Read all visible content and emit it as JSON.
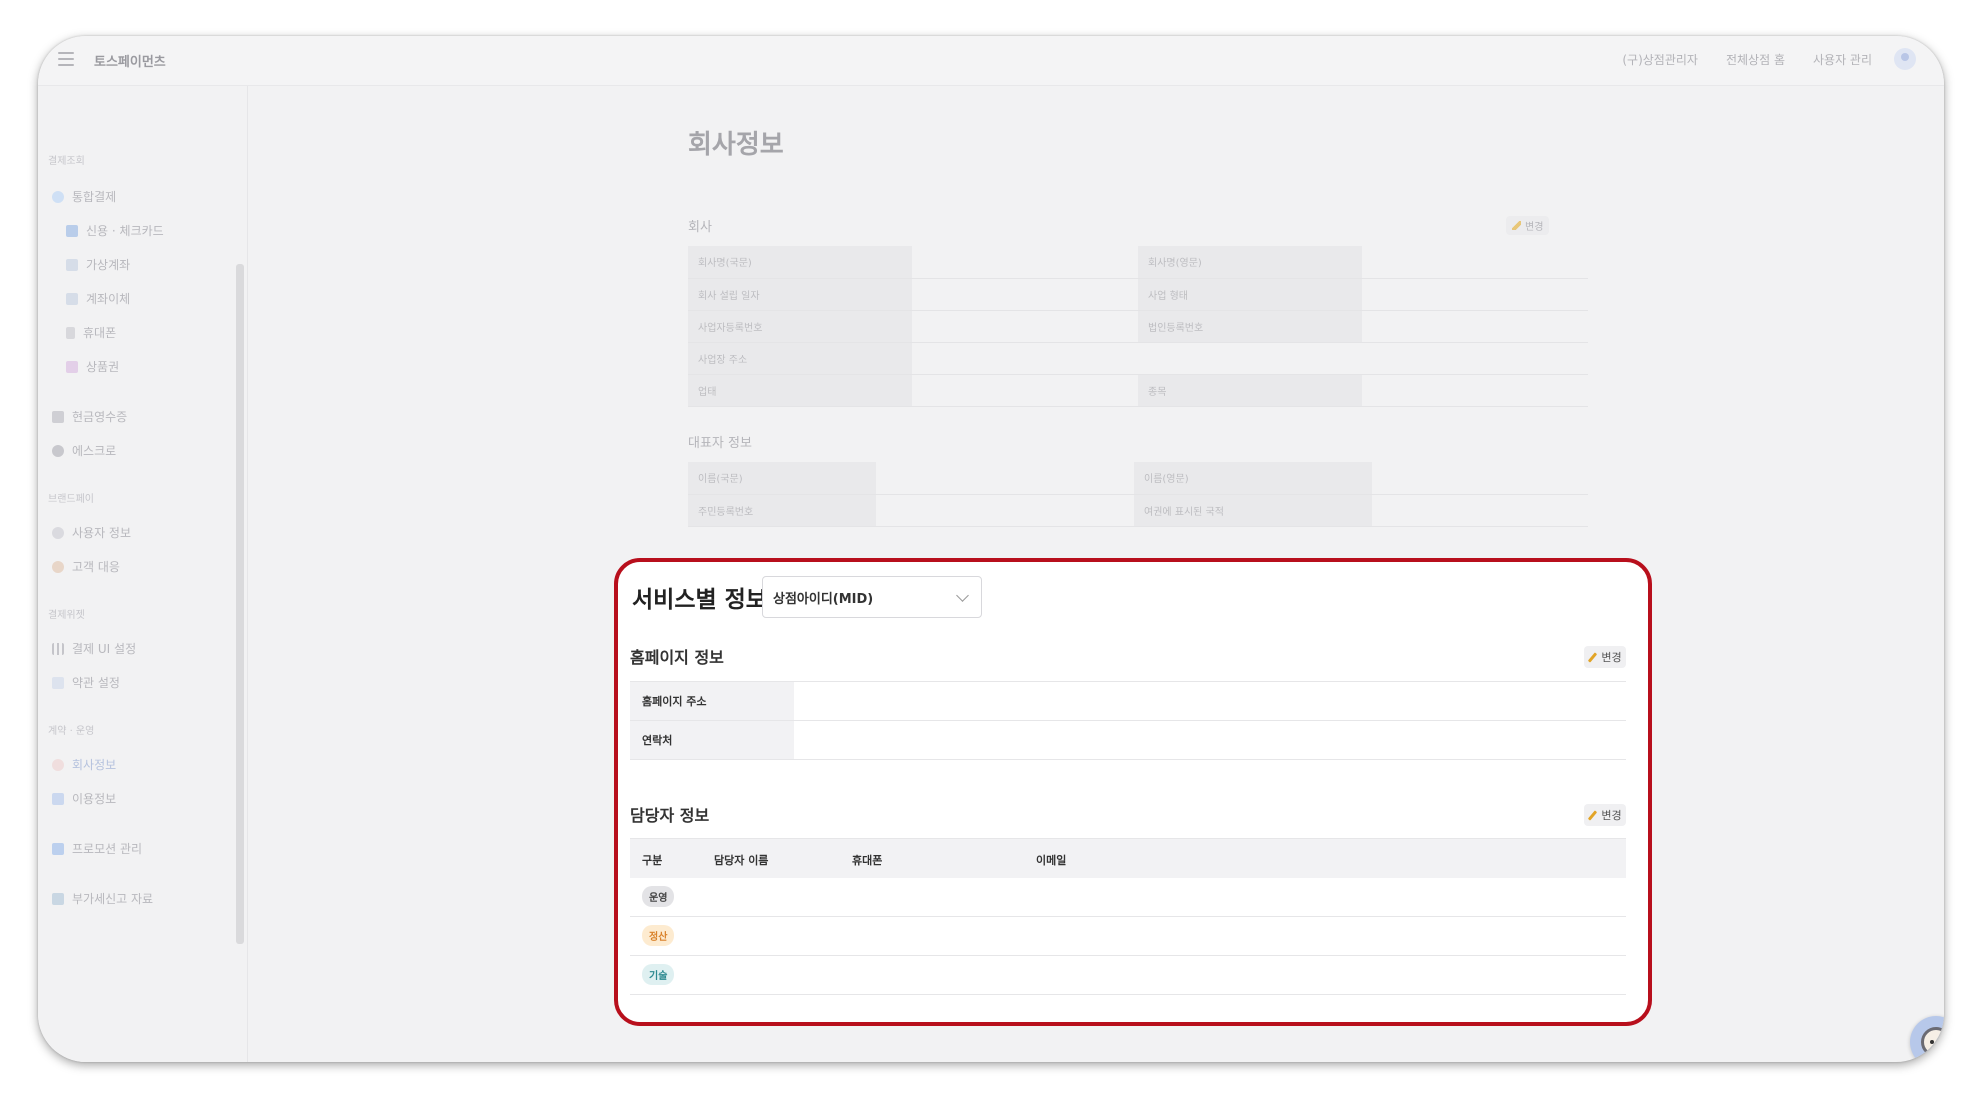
{
  "header": {
    "brand": "토스페이먼츠",
    "nav": [
      "(구)상점관리자",
      "전체상점 홈",
      "사용자 관리"
    ]
  },
  "sidebar": {
    "sections": [
      {
        "label": "결제조회"
      },
      {
        "label": "브랜드페이"
      },
      {
        "label": "결제위젯"
      },
      {
        "label": "계약 · 운영"
      }
    ],
    "items": [
      {
        "label": "통합결제"
      },
      {
        "label": "신용 · 체크카드"
      },
      {
        "label": "가상계좌"
      },
      {
        "label": "계좌이체"
      },
      {
        "label": "휴대폰"
      },
      {
        "label": "상품권"
      },
      {
        "label": "현금영수증"
      },
      {
        "label": "에스크로"
      },
      {
        "label": "사용자 정보"
      },
      {
        "label": "고객 대응"
      },
      {
        "label": "결제 UI 설정"
      },
      {
        "label": "약관 설정"
      },
      {
        "label": "회사정보"
      },
      {
        "label": "이용정보"
      },
      {
        "label": "프로모션 관리"
      },
      {
        "label": "부가세신고 자료"
      }
    ]
  },
  "main": {
    "page_title": "회사정보",
    "company": {
      "label": "회사",
      "edit_label": "변경",
      "rows": [
        [
          "회사명(국문)",
          "회사명(영문)"
        ],
        [
          "회사 설립 일자",
          "사업 형태"
        ],
        [
          "사업자등록번호",
          "법인등록번호"
        ],
        [
          "사업장 주소",
          ""
        ],
        [
          "업태",
          "종목"
        ]
      ]
    },
    "representative": {
      "label": "대표자 정보",
      "rows": [
        [
          "이름(국문)",
          "이름(영문)"
        ],
        [
          "주민등록번호",
          "여권에 표시된 국적"
        ]
      ]
    }
  },
  "service_panel": {
    "title": "서비스별 정보",
    "dropdown_value": "상점아이디(MID)",
    "homepage": {
      "title": "홈페이지 정보",
      "edit_label": "변경",
      "rows": [
        {
          "label": "홈페이지 주소",
          "value": ""
        },
        {
          "label": "연락처",
          "value": ""
        }
      ]
    },
    "managers": {
      "title": "담당자 정보",
      "edit_label": "변경",
      "columns": [
        "구분",
        "담당자 이름",
        "휴대폰",
        "이메일"
      ],
      "rows": [
        {
          "type": "운영",
          "color": "#e3e3e6",
          "text_color": "#444444"
        },
        {
          "type": "정산",
          "color": "#fdebd0",
          "text_color": "#d9822b"
        },
        {
          "type": "기술",
          "color": "#dff0f1",
          "text_color": "#2e8a91"
        }
      ]
    }
  },
  "colors": {
    "highlight_border": "#b80f1c",
    "edit_pencil": "#e2a427"
  }
}
